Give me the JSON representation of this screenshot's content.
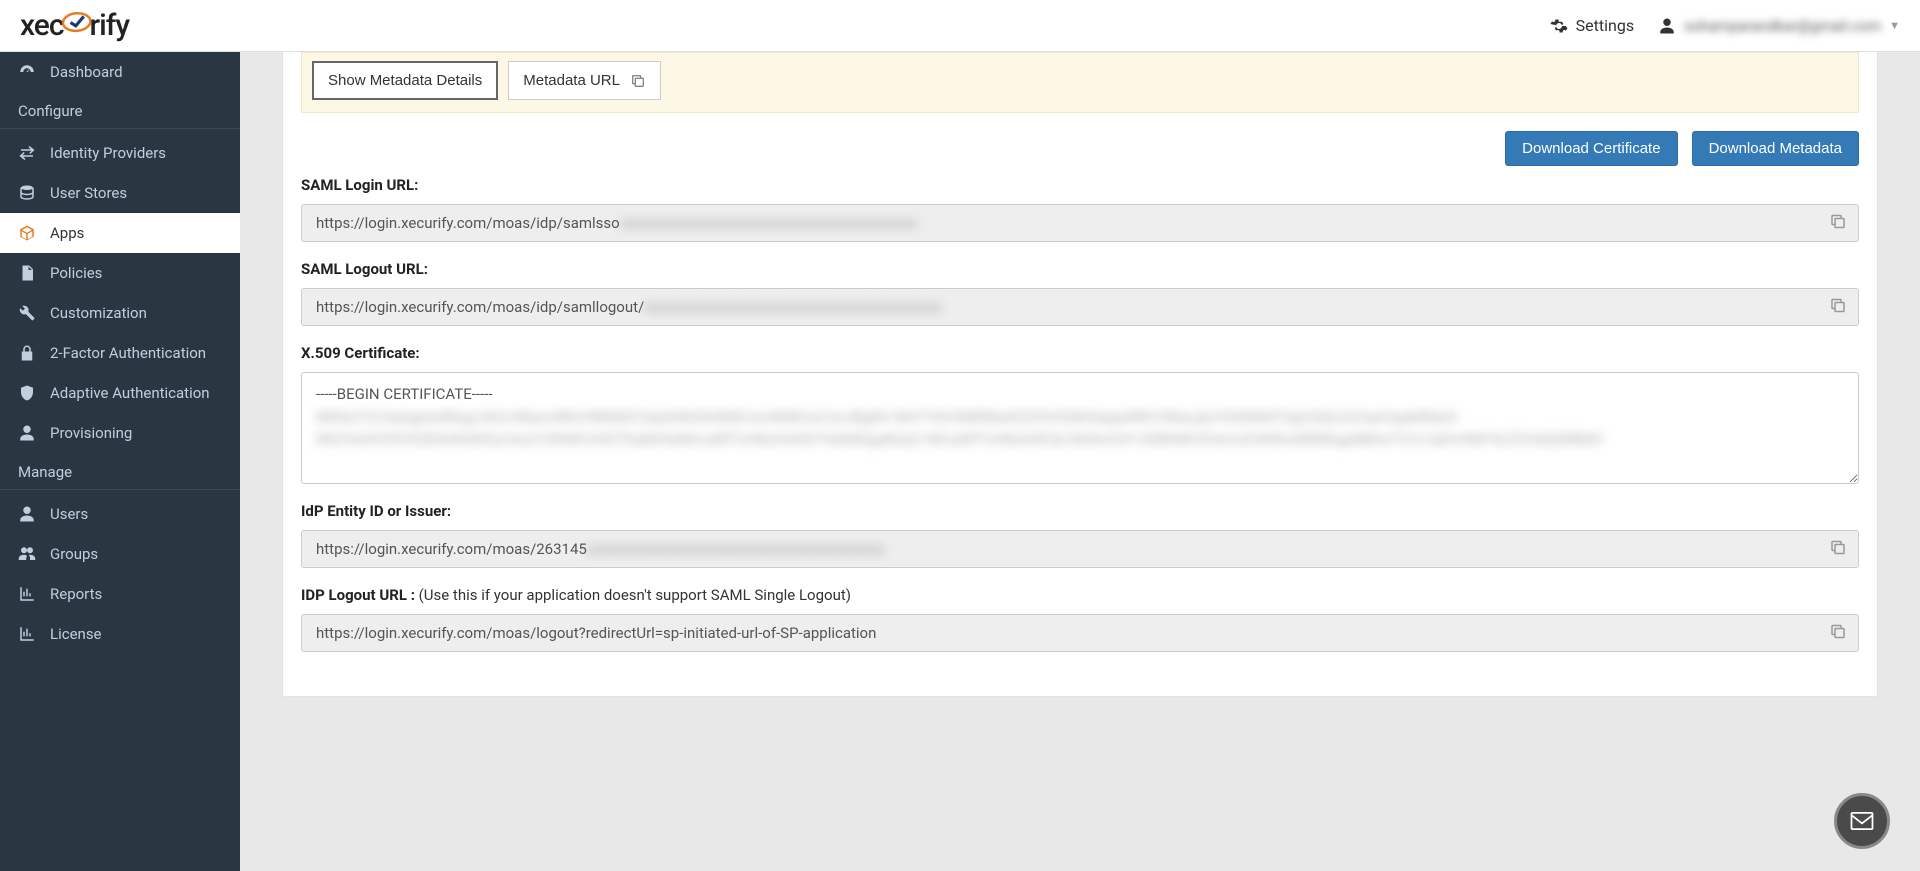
{
  "header": {
    "logo_text_pre": "xec",
    "logo_text_post": "rify",
    "settings_label": "Settings",
    "user_email_blurred": "sohamparandkar@gmail.com"
  },
  "sidebar": {
    "items_top": [
      {
        "icon": "dashboard",
        "label": "Dashboard"
      }
    ],
    "heading_configure": "Configure",
    "items_configure": [
      {
        "icon": "exchange",
        "label": "Identity Providers"
      },
      {
        "icon": "database",
        "label": "User Stores"
      },
      {
        "icon": "cube",
        "label": "Apps",
        "active": true
      },
      {
        "icon": "file",
        "label": "Policies"
      },
      {
        "icon": "wrench",
        "label": "Customization"
      },
      {
        "icon": "lock",
        "label": "2-Factor Authentication"
      },
      {
        "icon": "shield",
        "label": "Adaptive Authentication"
      },
      {
        "icon": "user",
        "label": "Provisioning"
      }
    ],
    "heading_manage": "Manage",
    "items_manage": [
      {
        "icon": "user",
        "label": "Users"
      },
      {
        "icon": "users",
        "label": "Groups"
      },
      {
        "icon": "chart",
        "label": "Reports"
      },
      {
        "icon": "chart",
        "label": "License"
      }
    ]
  },
  "metadata_tabs": {
    "show_details": "Show Metadata Details",
    "url_tab": "Metadata URL"
  },
  "actions": {
    "download_cert": "Download Certificate",
    "download_meta": "Download Metadata"
  },
  "fields": {
    "saml_login": {
      "label": "SAML Login URL:",
      "value_visible": "https://login.xecurify.com/moas/idp/samlsso",
      "value_obscured": "xxxxxxxxxxxxxxxxxxxxxxxxxxxxxxxxxxxxxxxx"
    },
    "saml_logout": {
      "label": "SAML Logout URL:",
      "value_visible": "https://login.xecurify.com/moas/idp/samllogout/",
      "value_obscured": "xxxxxxxxxxxxxxxxxxxxxxxxxxxxxxxxxxxxxxxx"
    },
    "x509": {
      "label": "X.509 Certificate:",
      "line1": "-----BEGIN CERTIFICATE-----",
      "obscured_lines": "MIIDyTCCAqGgAwIBAgIJAOc3KjavHBfcHRMdOCSqGSIb3DQEBCwUAMEUxCzAJBgNV\nBAYTAlVSMRMwEQYDVSQKDApjaXRhY3NsLjEyYGSDMATGgVQQLExFaeiVqabRhb2t\nMQYwDAYDVSQDDAlhdGFjc2wuY29tMCAXDTEqNDAyNDcyMTUvMzAXAlD7tekMDgqNUp2\nNDcyMTUvMzAXEQLUbGlmOA1UEBhMCSUxmcEAWEwMlMDgqNBAoTCm1pbml4bF4zZ2UxEjQMBdV"
    },
    "idp_entity": {
      "label": "IdP Entity ID or Issuer:",
      "value_visible": "https://login.xecurify.com/moas/263145",
      "value_obscured": "xxxxxxxxxxxxxxxxxxxxxxxxxxxxxxxxxxxxxxxx"
    },
    "idp_logout": {
      "label": "IDP Logout URL : ",
      "hint": "(Use this if your application doesn't support SAML Single Logout)",
      "value": "https://login.xecurify.com/moas/logout?redirectUrl=sp-initiated-url-of-SP-application"
    }
  }
}
